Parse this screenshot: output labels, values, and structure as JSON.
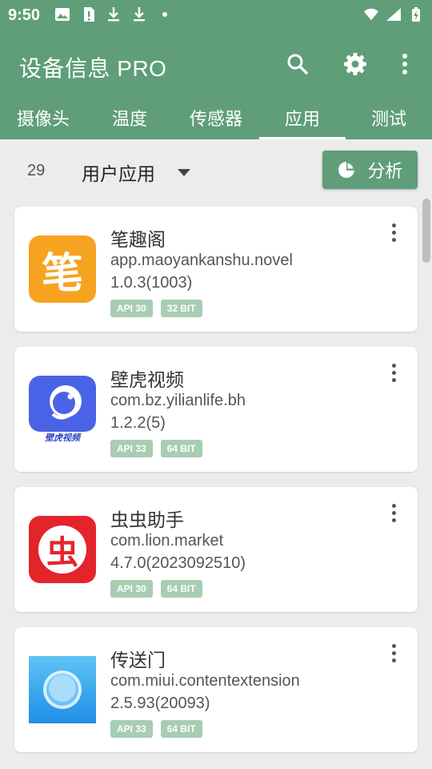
{
  "status": {
    "time": "9:50"
  },
  "app": {
    "title": "设备信息 PRO"
  },
  "tabs": [
    {
      "label": "摄像头"
    },
    {
      "label": "温度"
    },
    {
      "label": "传感器"
    },
    {
      "label": "应用",
      "active": true
    },
    {
      "label": "测试"
    }
  ],
  "filter": {
    "count": "29",
    "selected": "用户应用",
    "analyze_label": "分析"
  },
  "apps": [
    {
      "name": "笔趣阁",
      "package": "app.maoyankanshu.novel",
      "version": "1.0.3(1003)",
      "api": "API 30",
      "bits": "32 BIT",
      "icon": "biquge-app-icon",
      "icon_char": "笔"
    },
    {
      "name": "壁虎视频",
      "package": "com.bz.yilianlife.bh",
      "version": "1.2.2(5)",
      "api": "API 33",
      "bits": "64 BIT",
      "icon": "bihu-app-icon",
      "icon_caption": "壁虎视频"
    },
    {
      "name": "虫虫助手",
      "package": "com.lion.market",
      "version": "4.7.0(2023092510)",
      "api": "API 30",
      "bits": "64 BIT",
      "icon": "chongchong-app-icon",
      "icon_char": "虫"
    },
    {
      "name": "传送门",
      "package": "com.miui.contentextension",
      "version": "2.5.93(20093)",
      "api": "API 33",
      "bits": "64 BIT",
      "icon": "portal-app-icon"
    }
  ],
  "colors": {
    "primary": "#5f9e78",
    "badge": "#a7cdb3",
    "background": "#ececec"
  }
}
